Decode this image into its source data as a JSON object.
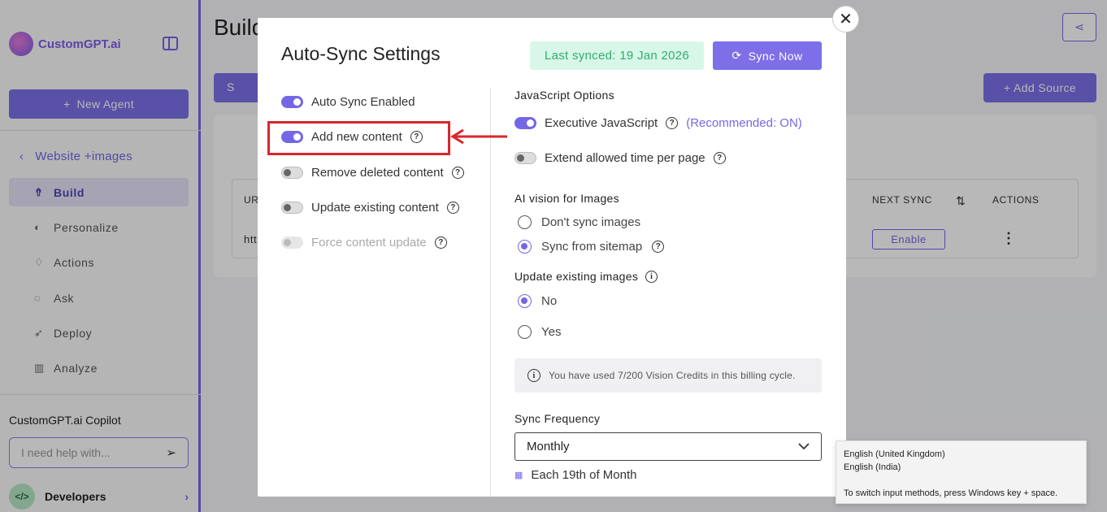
{
  "app": {
    "logo_text": "CustomGPT.ai",
    "new_agent_label": "New Agent",
    "breadcrumb": "Website +images",
    "nav": [
      {
        "label": "Build",
        "icon": "build-icon",
        "active": true
      },
      {
        "label": "Personalize",
        "icon": "palette-icon",
        "active": false
      },
      {
        "label": "Actions",
        "icon": "actions-icon",
        "active": false
      },
      {
        "label": "Ask",
        "icon": "chat-icon",
        "active": false
      },
      {
        "label": "Deploy",
        "icon": "rocket-icon",
        "active": false
      },
      {
        "label": "Analyze",
        "icon": "chart-icon",
        "active": false
      }
    ],
    "copilot_title": "CustomGPT.ai Copilot",
    "copilot_placeholder": "I need help with...",
    "developers_label": "Developers",
    "page_title": "Build",
    "tab_label": "S",
    "add_source_label": "Add Source",
    "table_headers": {
      "url": "UR",
      "next_sync": "NEXT SYNC",
      "actions": "ACTIONS"
    },
    "row_url": "htt",
    "enable_label": "Enable",
    "accent_color": "#7467e6"
  },
  "modal": {
    "title": "Auto-Sync Settings",
    "last_synced": "Last synced: 19 Jan 2026",
    "sync_now_label": "Sync Now",
    "left_toggles": [
      {
        "label": "Auto Sync Enabled",
        "on": true,
        "help": false,
        "disabled": false
      },
      {
        "label": "Add new content",
        "on": true,
        "help": true,
        "disabled": false
      },
      {
        "label": "Remove deleted content",
        "on": false,
        "help": true,
        "disabled": false
      },
      {
        "label": "Update existing content",
        "on": false,
        "help": true,
        "disabled": false
      },
      {
        "label": "Force content update",
        "on": false,
        "help": true,
        "disabled": true
      }
    ],
    "js_options_title": "JavaScript Options",
    "exec_js_label": "Executive JavaScript",
    "exec_js_recommend": "(Recommended: ON)",
    "extend_time_label": "Extend allowed time per page",
    "ai_vision_title": "AI vision for Images",
    "vision_options": [
      {
        "label": "Don't sync images",
        "selected": false
      },
      {
        "label": "Sync from sitemap",
        "selected": true
      }
    ],
    "update_images_title": "Update existing images",
    "update_images_options": [
      {
        "label": "No",
        "selected": true
      },
      {
        "label": "Yes",
        "selected": false
      }
    ],
    "credits_text": "You have used 7/200 Vision Credits in this billing cycle.",
    "sync_frequency_title": "Sync Frequency",
    "sync_frequency_value": "Monthly",
    "schedule_text": "Each 19th of Month"
  },
  "ime_tooltip": {
    "line1": "English (United Kingdom)",
    "line2": "English (India)",
    "hint": "To switch input methods, press Windows key + space."
  }
}
